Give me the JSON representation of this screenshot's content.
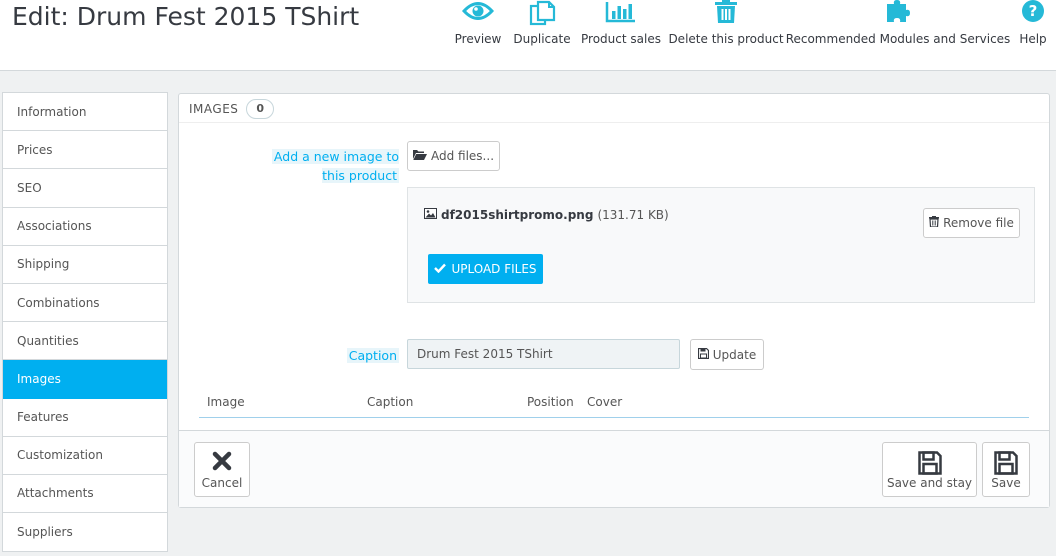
{
  "header": {
    "title": "Edit: Drum Fest 2015 TShirt",
    "toolbar": [
      {
        "label": "Preview",
        "icon": "eye-icon"
      },
      {
        "label": "Duplicate",
        "icon": "copy-icon"
      },
      {
        "label": "Product sales",
        "icon": "bar-chart-icon"
      },
      {
        "label": "Delete this product",
        "icon": "trash-icon"
      },
      {
        "label": "Recommended Modules and Services",
        "icon": "puzzle-icon"
      },
      {
        "label": "Help",
        "icon": "help-icon"
      }
    ]
  },
  "tabs": [
    {
      "label": "Information",
      "active": false
    },
    {
      "label": "Prices",
      "active": false
    },
    {
      "label": "SEO",
      "active": false
    },
    {
      "label": "Associations",
      "active": false
    },
    {
      "label": "Shipping",
      "active": false
    },
    {
      "label": "Combinations",
      "active": false
    },
    {
      "label": "Quantities",
      "active": false
    },
    {
      "label": "Images",
      "active": true
    },
    {
      "label": "Features",
      "active": false
    },
    {
      "label": "Customization",
      "active": false
    },
    {
      "label": "Attachments",
      "active": false
    },
    {
      "label": "Suppliers",
      "active": false
    }
  ],
  "panel": {
    "heading": "IMAGES",
    "count": "0",
    "add_image_label": "Add a new image to this product",
    "add_files_button": "Add files...",
    "file": {
      "name": "df2015shirtpromo.png",
      "size": "(131.71 KB)"
    },
    "remove_file_button": "Remove file",
    "upload_button": "UPLOAD FILES",
    "caption_label": "Caption",
    "caption_value": "Drum Fest 2015 TShirt",
    "update_button": "Update",
    "columns": [
      "Image",
      "Caption",
      "Position",
      "Cover"
    ],
    "cancel_button": "Cancel",
    "save_and_stay_button": "Save and stay",
    "save_button": "Save"
  },
  "colors": {
    "accent": "#00aff0",
    "title": "#363a41",
    "text": "#555555"
  }
}
